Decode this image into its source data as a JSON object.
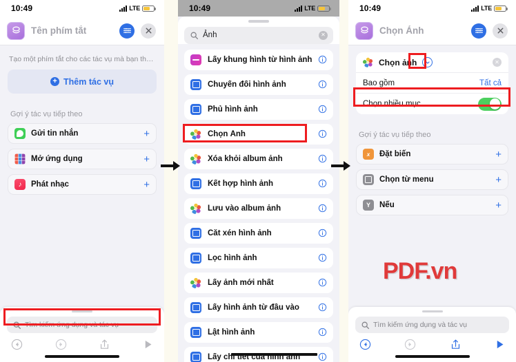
{
  "status_bar": {
    "time": "10:49",
    "network": "LTE"
  },
  "panel1": {
    "nav": {
      "title": "Tên phím tắt",
      "app_icon": "shortcuts-icon",
      "settings_icon": "sliders-icon",
      "close_icon": "close-icon"
    },
    "hint": "Tạo một phím tắt cho các tác vụ mà bạn thực hi...",
    "add_action_label": "Thêm tác vụ",
    "suggestions_title": "Gợi ý tác vụ tiếp theo",
    "suggestions": [
      {
        "label": "Gửi tin nhắn",
        "icon": "messages-icon",
        "add": "+"
      },
      {
        "label": "Mở ứng dụng",
        "icon": "app-grid-icon",
        "add": "+"
      },
      {
        "label": "Phát nhạc",
        "icon": "music-icon",
        "add": "+"
      }
    ],
    "search_placeholder": "Tìm kiếm ứng dụng và tác vụ",
    "toolbar": {
      "undo": "undo-icon",
      "redo": "redo-icon",
      "share": "share-icon",
      "play": "play-icon"
    }
  },
  "panel2": {
    "search_value": "Ảnh",
    "clear_icon": "clear-icon",
    "results": [
      {
        "label": "Lấy khung hình từ hình ảnh",
        "icon": "magenta-frame-icon"
      },
      {
        "label": "Chuyển đổi hình ảnh",
        "icon": "media-icon"
      },
      {
        "label": "Phủ hình ảnh",
        "icon": "media-icon"
      },
      {
        "label": "Chọn Ảnh",
        "icon": "photos-icon"
      },
      {
        "label": "Xóa khỏi album ảnh",
        "icon": "photos-icon"
      },
      {
        "label": "Kết hợp hình ảnh",
        "icon": "media-icon"
      },
      {
        "label": "Lưu vào album ảnh",
        "icon": "photos-icon"
      },
      {
        "label": "Cắt xén hình ảnh",
        "icon": "media-icon"
      },
      {
        "label": "Lọc hình ảnh",
        "icon": "media-icon"
      },
      {
        "label": "Lấy ảnh mới nhất",
        "icon": "photos-icon"
      },
      {
        "label": "Lấy hình ảnh từ đầu vào",
        "icon": "media-icon"
      },
      {
        "label": "Lật hình ảnh",
        "icon": "media-icon"
      },
      {
        "label": "Lấy chi tiết của hình ảnh",
        "icon": "media-icon"
      }
    ],
    "info_icon": "info-icon"
  },
  "panel3": {
    "nav": {
      "title": "Chọn Ảnh",
      "app_icon": "shortcuts-icon",
      "settings_icon": "sliders-icon",
      "close_icon": "close-icon"
    },
    "action": {
      "title": "Chọn ảnh",
      "icon": "photos-icon",
      "expand_icon": "chevron-down-icon",
      "remove_icon": "remove-icon",
      "include_label": "Bao gồm",
      "include_value": "Tất cả",
      "multi_label": "Chọn nhiều mục",
      "multi_on": true
    },
    "suggestions_title": "Gợi ý tác vụ tiếp theo",
    "suggestions": [
      {
        "label": "Đặt biến",
        "icon": "variable-icon",
        "add": "+"
      },
      {
        "label": "Chọn từ menu",
        "icon": "menu-icon",
        "add": "+"
      },
      {
        "label": "Nếu",
        "icon": "if-icon",
        "add": "+"
      }
    ],
    "search_placeholder": "Tìm kiếm ứng dụng và tác vụ",
    "toolbar": {
      "undo": "undo-icon",
      "redo": "redo-icon",
      "share": "share-icon",
      "play": "play-icon"
    }
  },
  "watermark": "PDF.vn",
  "colors": {
    "accent": "#2F6FE4",
    "highlight": "#EE1C20",
    "toggle_on": "#4CD05E",
    "background": "#FCFAEF"
  }
}
